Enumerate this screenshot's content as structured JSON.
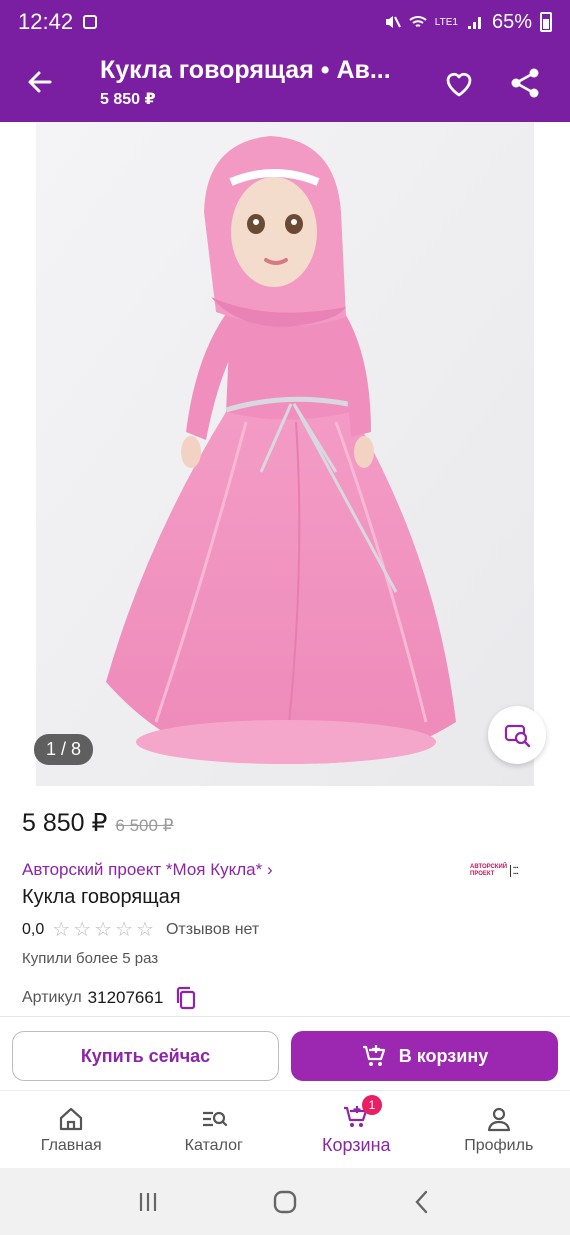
{
  "status_bar": {
    "time": "12:42",
    "battery": "65%",
    "network": "LTE1"
  },
  "app_bar": {
    "title": "Кукла говорящая • Ав...",
    "subtitle": "5 850 ₽"
  },
  "gallery": {
    "counter": "1 / 8"
  },
  "product": {
    "price": "5 850 ₽",
    "old_price": "6 500 ₽",
    "brand": "Авторский проект *Моя Кукла* ›",
    "brand_logo_line1": "АВТОРСКИЙ",
    "brand_logo_line2": "ПРОЕКТ",
    "name": "Кукла говорящая",
    "rating": "0,0",
    "reviews": "Отзывов нет",
    "bought": "Купили более 5 раз",
    "article_label": "Артикул",
    "article_value": "31207661"
  },
  "actions": {
    "buy_now": "Купить сейчас",
    "to_cart": "В корзину"
  },
  "bottom_nav": {
    "items": [
      {
        "label": "Главная",
        "icon": "home-icon"
      },
      {
        "label": "Каталог",
        "icon": "catalog-search-icon"
      },
      {
        "label": "Корзина",
        "icon": "cart-icon",
        "badge": "1"
      },
      {
        "label": "Профиль",
        "icon": "profile-icon"
      }
    ],
    "active": "Корзина"
  },
  "colors": {
    "brand": "#7b1fa2",
    "accent": "#9c27b0",
    "badge": "#e91e63"
  }
}
